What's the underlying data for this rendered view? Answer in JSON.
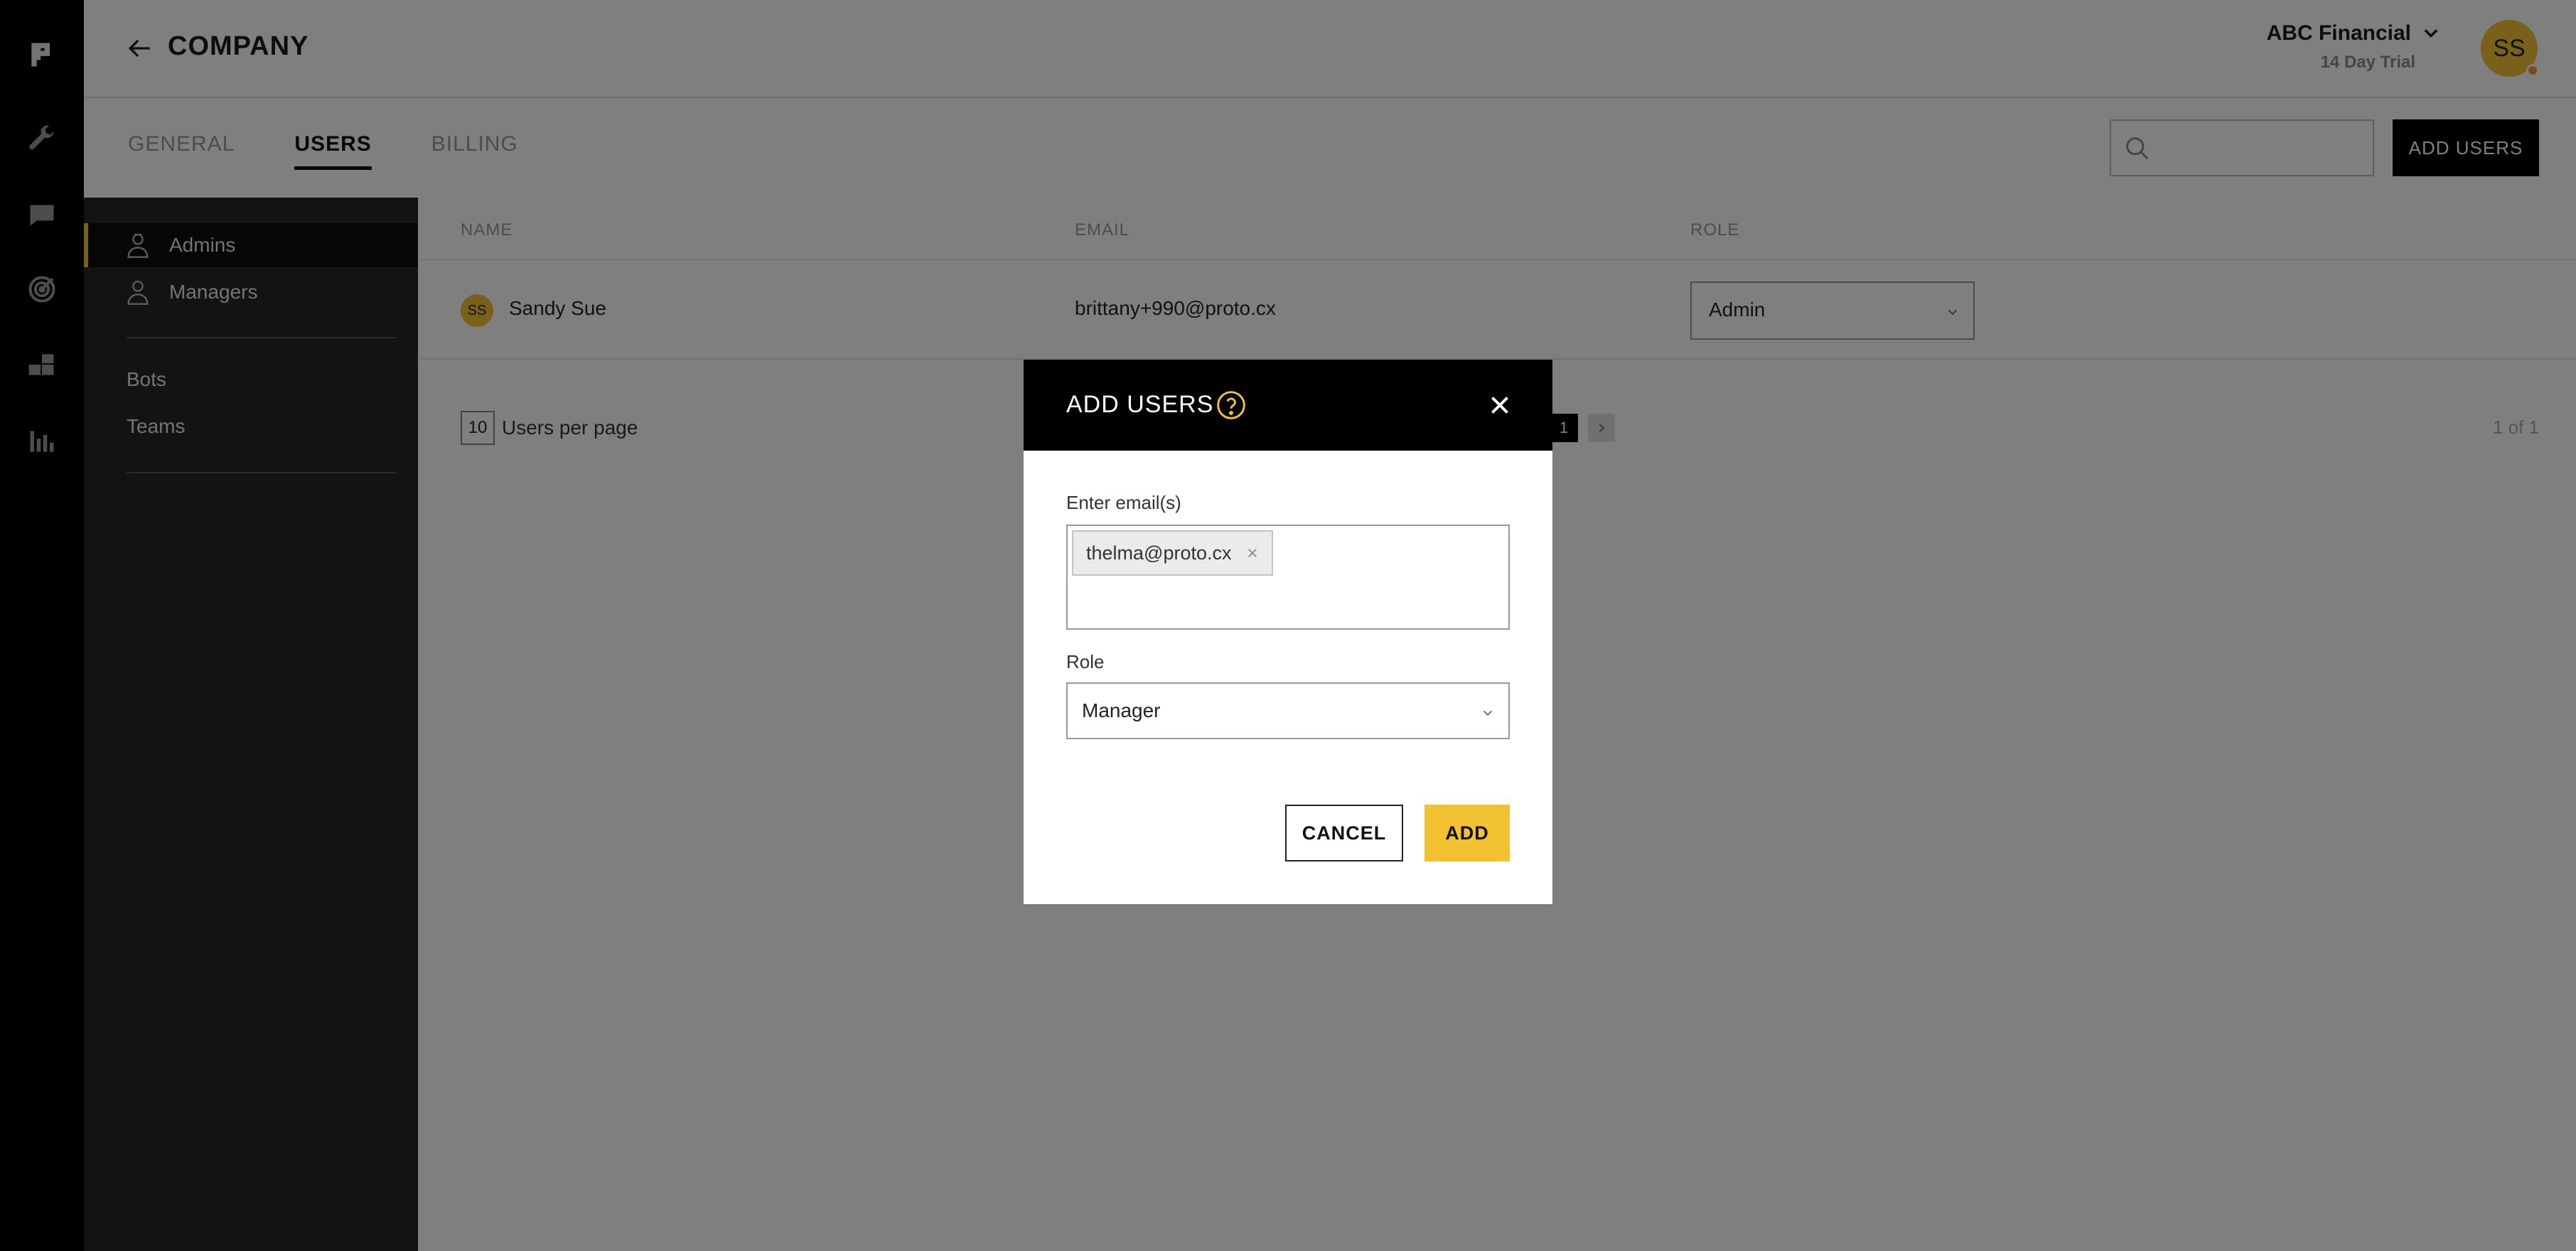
{
  "rail": {
    "icons": [
      "proto-logo-icon",
      "wrench-icon",
      "chat-icon",
      "target-icon",
      "blocks-icon",
      "bar-chart-icon"
    ]
  },
  "header": {
    "title": "COMPANY",
    "company_name": "ABC Financial",
    "trial": "14 Day Trial",
    "avatar_initials": "SS"
  },
  "tabs": [
    {
      "label": "GENERAL"
    },
    {
      "label": "USERS"
    },
    {
      "label": "BILLING"
    }
  ],
  "search": {
    "placeholder": ""
  },
  "toolbar": {
    "add_users_label": "ADD USERS"
  },
  "subnav": {
    "items": [
      {
        "label": "Admins"
      },
      {
        "label": "Managers"
      },
      {
        "label": "Bots"
      },
      {
        "label": "Teams"
      }
    ]
  },
  "table": {
    "headers": [
      "NAME",
      "EMAIL",
      "ROLE"
    ],
    "rows": [
      {
        "initials": "SS",
        "name": "Sandy Sue",
        "email": "brittany+990@proto.cx",
        "role": "Admin"
      }
    ]
  },
  "pagination": {
    "per_page": "10",
    "per_page_label": "Users per page",
    "current_page": "1",
    "summary": "1 of 1"
  },
  "modal": {
    "title": "ADD USERS",
    "email_label": "Enter email(s)",
    "emails": [
      "thelma@proto.cx"
    ],
    "role_label": "Role",
    "role_value": "Manager",
    "cancel_label": "CANCEL",
    "add_label": "ADD"
  },
  "colors": {
    "accent": "#f2c233",
    "rail_bg": "#000000",
    "subnav_bg": "#262626"
  }
}
